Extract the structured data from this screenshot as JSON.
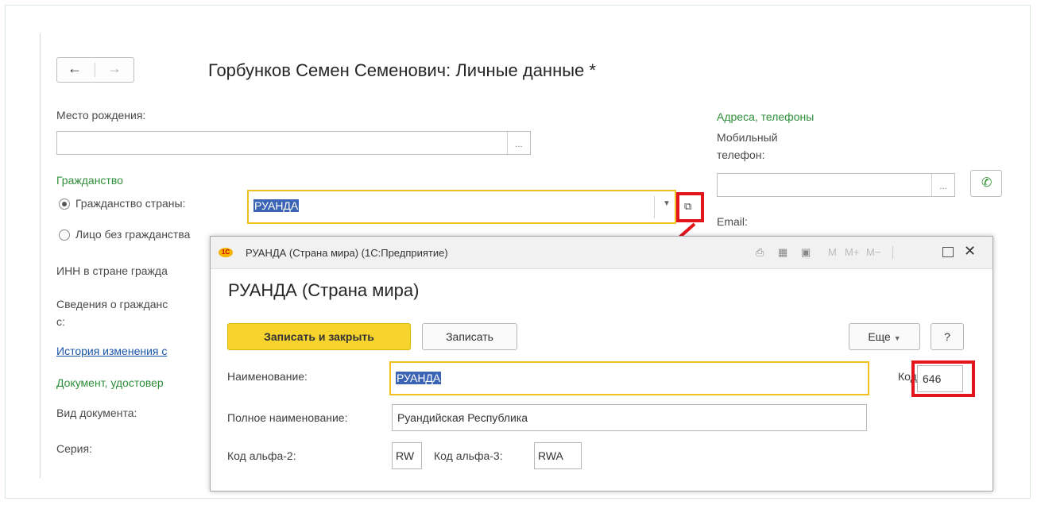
{
  "window": {
    "title": "Горбунков Семен Семенович: Личные данные *",
    "nav_back": "←",
    "nav_forward": "→"
  },
  "form": {
    "birthplace_label": "Место рождения:",
    "birthplace_value": "",
    "citizenship_heading": "Гражданство",
    "radio_country_label": "Гражданство страны:",
    "radio_country_selected": true,
    "country_value": "РУАНДА",
    "radio_stateless_label": "Лицо без гражданства",
    "inn_label": "ИНН в стране гражда",
    "citizenship_info_label_1": "Сведения о гражданс",
    "citizenship_info_label_2": "с:",
    "history_link": "История изменения с",
    "document_heading": "Документ, удостовер",
    "doc_type_label": "Вид документа:",
    "series_label": "Серия:"
  },
  "contacts": {
    "heading": "Адреса, телефоны",
    "mobile_label_1": "Мобильный",
    "mobile_label_2": "телефон:",
    "mobile_value": "",
    "email_label": "Email:"
  },
  "popup": {
    "titlebar_text": "РУАНДА (Страна мира) (1С:Предприятие)",
    "logo_text": "1С",
    "toolbar_icons": [
      "print-icon",
      "calculator-icon",
      "calendar-icon"
    ],
    "toolbar_m": "M",
    "toolbar_mplus": "M+",
    "toolbar_mminus": "M−",
    "heading": "РУАНДА (Страна мира)",
    "save_close_label": "Записать и закрыть",
    "save_label": "Записать",
    "more_label": "Еще",
    "help_label": "?",
    "name_label": "Наименование:",
    "name_value": "РУАНДА",
    "code_label": "Код",
    "code_value": "646",
    "fullname_label": "Полное наименование:",
    "fullname_value": "Руандийская Республика",
    "alpha2_label": "Код альфа-2:",
    "alpha2_value": "RW",
    "alpha3_label": "Код альфа-3:",
    "alpha3_value": "RWA"
  },
  "colors": {
    "highlight_red": "#e3141b",
    "section_green": "#2f8f3a",
    "primary_button_yellow": "#f6d32d",
    "selection_blue": "#3c64b4",
    "link_blue": "#1a55a8"
  }
}
